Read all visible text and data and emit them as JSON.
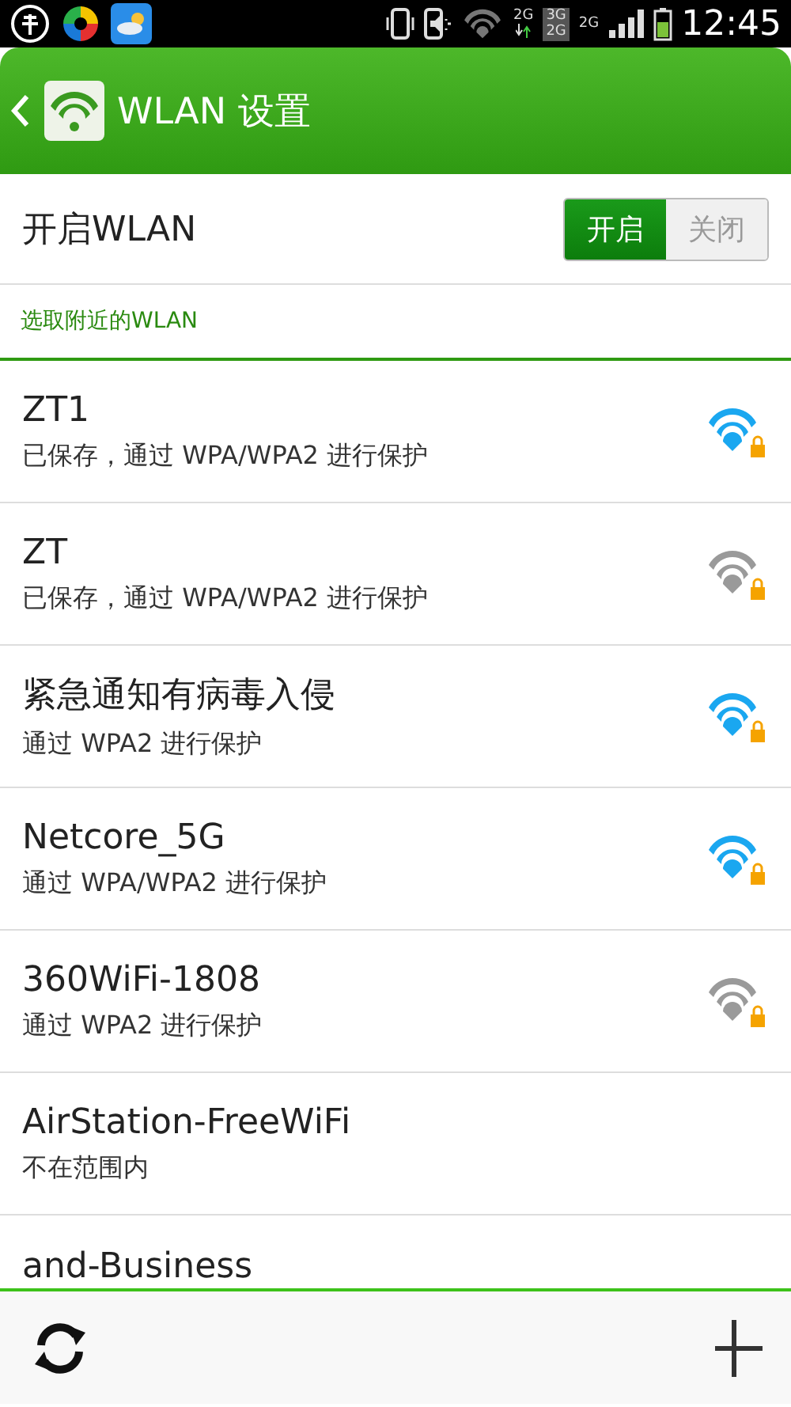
{
  "status_bar": {
    "data_label": "2G",
    "sim_labels": [
      "3G",
      "2G"
    ],
    "signal_label": "2G",
    "time": "12:45"
  },
  "header": {
    "title": "WLAN 设置"
  },
  "wlan_toggle": {
    "label": "开启WLAN",
    "options": [
      {
        "label": "开启",
        "selected": true
      },
      {
        "label": "关闭",
        "selected": false
      }
    ]
  },
  "section": {
    "title": "选取附近的WLAN"
  },
  "networks": [
    {
      "name": "ZT1",
      "detail": "已保存，通过 WPA/WPA2 进行保护",
      "strong_signal": true,
      "locked": true
    },
    {
      "name": "ZT",
      "detail": "已保存，通过 WPA/WPA2 进行保护",
      "strong_signal": false,
      "locked": true
    },
    {
      "name": "紧急通知有病毒入侵",
      "detail": "通过 WPA2 进行保护",
      "strong_signal": true,
      "locked": true
    },
    {
      "name": "Netcore_5G",
      "detail": "通过 WPA/WPA2 进行保护",
      "strong_signal": true,
      "locked": true
    },
    {
      "name": "360WiFi-1808",
      "detail": "通过 WPA2 进行保护",
      "strong_signal": false,
      "locked": true
    },
    {
      "name": "AirStation-FreeWiFi",
      "detail": "不在范围内"
    },
    {
      "name": "and-Business"
    }
  ]
}
